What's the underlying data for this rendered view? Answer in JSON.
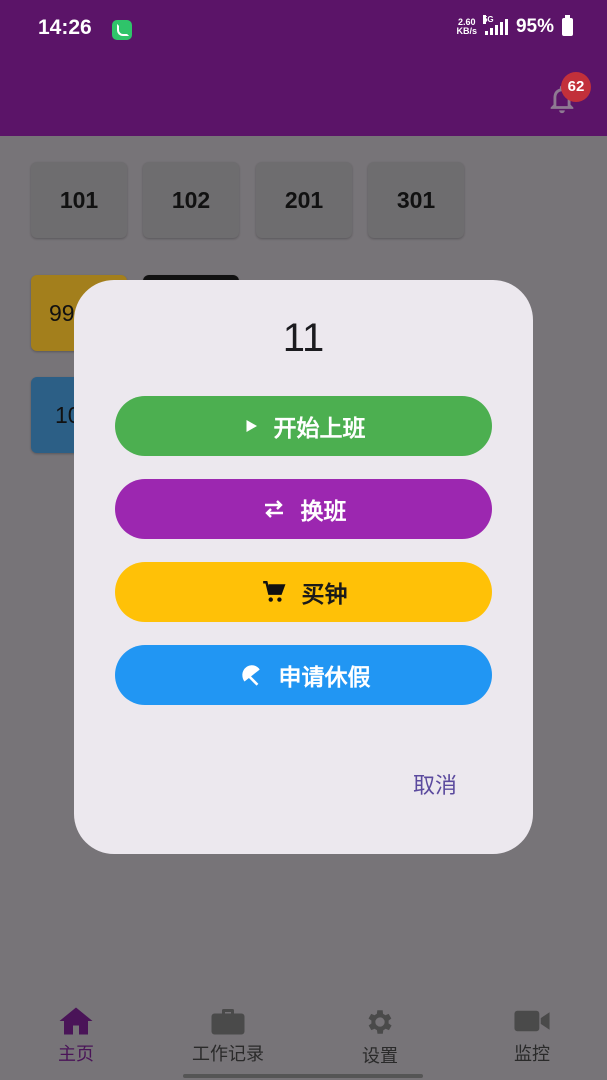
{
  "status_bar": {
    "time": "14:26",
    "net_speed_value": "2.60",
    "net_speed_unit": "KB/s",
    "network_type": "5G",
    "battery": "95%"
  },
  "header": {
    "notification_count": "62"
  },
  "rooms": [
    "101",
    "102",
    "201",
    "301"
  ],
  "partial_tiles": {
    "yellow": "99",
    "blue": "10"
  },
  "dialog": {
    "title": "11",
    "actions": [
      {
        "label": "开始上班",
        "icon": "play-icon",
        "color": "#4caf50"
      },
      {
        "label": "换班",
        "icon": "swap-icon",
        "color": "#9c27b0"
      },
      {
        "label": "买钟",
        "icon": "cart-icon",
        "color": "#ffc107"
      },
      {
        "label": "申请休假",
        "icon": "beach-umbrella-icon",
        "color": "#2196f3"
      }
    ],
    "cancel_label": "取消"
  },
  "bottom_nav": [
    {
      "label": "主页",
      "icon": "home-icon",
      "active": true
    },
    {
      "label": "工作记录",
      "icon": "briefcase-icon",
      "active": false
    },
    {
      "label": "设置",
      "icon": "gear-icon",
      "active": false
    },
    {
      "label": "监控",
      "icon": "video-camera-icon",
      "active": false
    }
  ],
  "colors": {
    "app_bar": "#5b1468",
    "scrim": "#777478",
    "dialog_bg": "#ece8ee",
    "accent": "#5b4a9e"
  }
}
